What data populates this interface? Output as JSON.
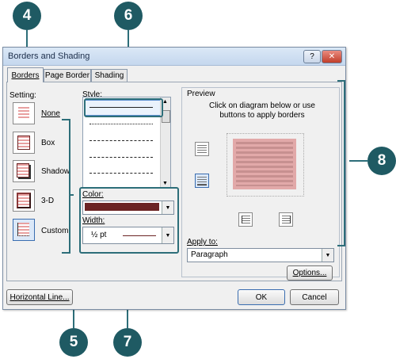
{
  "callouts": [
    "4",
    "6",
    "5",
    "7",
    "8"
  ],
  "dialog": {
    "title": "Borders and Shading",
    "help_button": "?",
    "close_button": "✕",
    "tabs": [
      "Borders",
      "Page Border",
      "Shading"
    ]
  },
  "setting": {
    "heading": "Setting:",
    "options": [
      "None",
      "Box",
      "Shadow",
      "3-D",
      "Custom"
    ]
  },
  "style": {
    "heading": "Style:"
  },
  "color": {
    "heading": "Color:",
    "value_hex": "#6b2424"
  },
  "width": {
    "heading": "Width:",
    "value": "½ pt"
  },
  "preview": {
    "heading": "Preview",
    "instruction": "Click on diagram below or use buttons to apply borders",
    "shading_color": "#e2a9a9"
  },
  "apply_to": {
    "heading": "Apply to:",
    "value": "Paragraph"
  },
  "buttons": {
    "options": "Options...",
    "horizontal_line": "Horizontal Line...",
    "ok": "OK",
    "cancel": "Cancel"
  }
}
